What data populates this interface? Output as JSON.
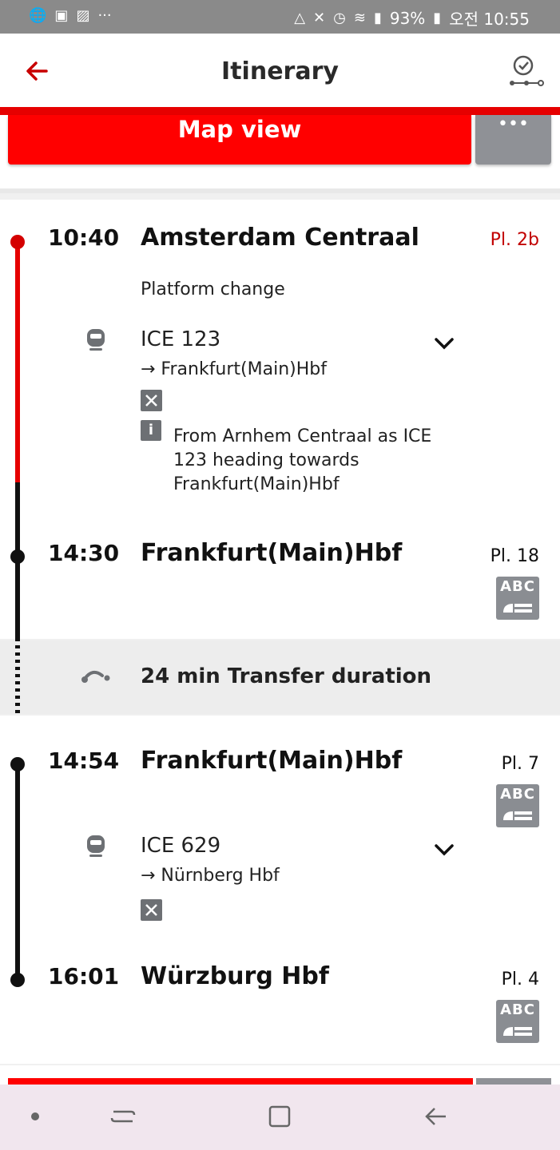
{
  "status_bar": {
    "left_icons": [
      "globe-icon",
      "notification-icon",
      "image-icon",
      "more-dots-icon"
    ],
    "battery": "93%",
    "time": "오전 10:55"
  },
  "app_bar": {
    "title": "Itinerary"
  },
  "map_bar": {
    "map_label": "Map view",
    "more_label": "•••"
  },
  "itinerary": {
    "stop1": {
      "time": "10:40",
      "station": "Amsterdam Centraal",
      "platform": "Pl. 2b",
      "platform_note": "Platform change"
    },
    "leg1": {
      "train": "ICE 123",
      "destination": "→ Frankfurt(Main)Hbf",
      "info": "From Arnhem Centraal as ICE 123 heading towards Frankfurt(Main)Hbf"
    },
    "stop2": {
      "time": "14:30",
      "station": "Frankfurt(Main)Hbf",
      "platform": "Pl. 18",
      "sector": "ABC"
    },
    "transfer": {
      "label": "24 min Transfer duration"
    },
    "stop3": {
      "time": "14:54",
      "station": "Frankfurt(Main)Hbf",
      "platform": "Pl. 7",
      "sector": "ABC"
    },
    "leg2": {
      "train": "ICE 629",
      "destination": "→ Nürnberg Hbf"
    },
    "stop4": {
      "time": "16:01",
      "station": "Würzburg Hbf",
      "platform": "Pl. 4",
      "sector": "ABC"
    }
  },
  "colors": {
    "accent_red": "#ff0000",
    "timeline_red": "#e60000",
    "timeline_black": "#111111",
    "gray_button": "#8f9196"
  }
}
